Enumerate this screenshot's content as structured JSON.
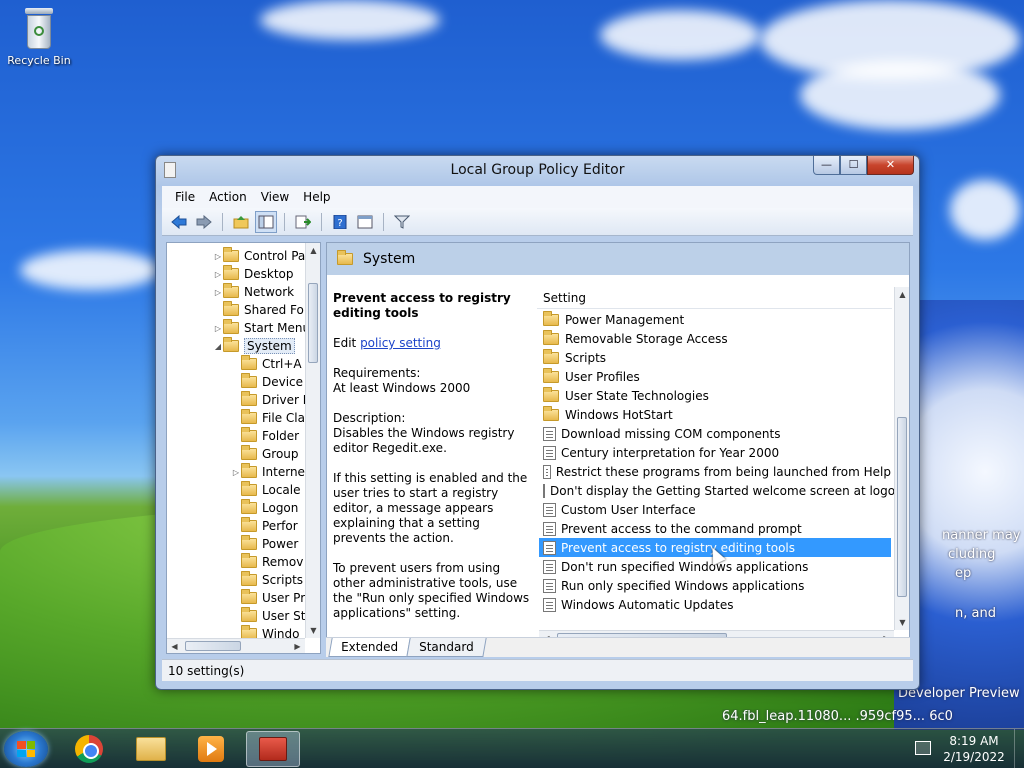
{
  "desktop": {
    "recycle_bin_label": "Recycle Bin",
    "wallpaper_text": {
      "line1": "nanner may",
      "line2": "cluding",
      "line3": "ep",
      "line4": "n, and",
      "developer": "Developer Preview",
      "build": "64.fbl_leap.11080... .959cf95... 6c0"
    }
  },
  "window": {
    "title": "Local Group Policy Editor",
    "controls": {
      "minimize": "—",
      "maximize": "☐",
      "close": "✕"
    },
    "menu": [
      "File",
      "Action",
      "View",
      "Help"
    ],
    "toolbar_icons": [
      "back-arrow-icon",
      "forward-arrow-icon",
      "up-folder-icon",
      "show-hide-tree-icon",
      "export-list-icon",
      "help-icon",
      "properties-icon",
      "filter-icon"
    ]
  },
  "tree": {
    "items": [
      {
        "label": "Control Pa",
        "expander": "▷",
        "level": 2
      },
      {
        "label": "Desktop",
        "expander": "▷",
        "level": 2
      },
      {
        "label": "Network",
        "expander": "▷",
        "level": 2
      },
      {
        "label": "Shared Fol",
        "expander": "",
        "level": 2
      },
      {
        "label": "Start Menu",
        "expander": "▷",
        "level": 2
      },
      {
        "label": "System",
        "expander": "◢",
        "level": 2,
        "selected": true
      },
      {
        "label": "Ctrl+A",
        "expander": "",
        "level": 3
      },
      {
        "label": "Device",
        "expander": "",
        "level": 3
      },
      {
        "label": "Driver I",
        "expander": "",
        "level": 3
      },
      {
        "label": "File Cla",
        "expander": "",
        "level": 3
      },
      {
        "label": "Folder",
        "expander": "",
        "level": 3
      },
      {
        "label": "Group",
        "expander": "",
        "level": 3
      },
      {
        "label": "Interne",
        "expander": "▷",
        "level": 3
      },
      {
        "label": "Locale",
        "expander": "",
        "level": 3
      },
      {
        "label": "Logon",
        "expander": "",
        "level": 3
      },
      {
        "label": "Perfor",
        "expander": "",
        "level": 3
      },
      {
        "label": "Power",
        "expander": "",
        "level": 3
      },
      {
        "label": "Remov",
        "expander": "",
        "level": 3
      },
      {
        "label": "Scripts",
        "expander": "",
        "level": 3
      },
      {
        "label": "User Pr",
        "expander": "",
        "level": 3
      },
      {
        "label": "User St",
        "expander": "",
        "level": 3
      },
      {
        "label": "Windo",
        "expander": "",
        "level": 3
      }
    ]
  },
  "right_pane": {
    "header": "System",
    "description": {
      "title": "Prevent access to registry editing tools",
      "edit_prefix": "Edit ",
      "edit_link": "policy setting",
      "requirements_label": "Requirements:",
      "requirements_value": "At least Windows 2000",
      "description_label": "Description:",
      "description_text": "Disables the Windows registry editor Regedit.exe.",
      "para2": "If this setting is enabled and the user tries to start a registry editor, a message appears explaining that a setting prevents the action.",
      "para3": "To prevent users from using other administrative tools, use the \"Run only specified Windows applications\" setting."
    },
    "list_header": "Setting",
    "rows": [
      {
        "label": "Power Management",
        "type": "folder"
      },
      {
        "label": "Removable Storage Access",
        "type": "folder"
      },
      {
        "label": "Scripts",
        "type": "folder"
      },
      {
        "label": "User Profiles",
        "type": "folder"
      },
      {
        "label": "User State Technologies",
        "type": "folder"
      },
      {
        "label": "Windows HotStart",
        "type": "folder"
      },
      {
        "label": "Download missing COM components",
        "type": "policy"
      },
      {
        "label": "Century interpretation for Year 2000",
        "type": "policy"
      },
      {
        "label": "Restrict these programs from being launched from Help",
        "type": "policy"
      },
      {
        "label": "Don't display the Getting Started welcome screen at logon",
        "type": "policy"
      },
      {
        "label": "Custom User Interface",
        "type": "policy"
      },
      {
        "label": "Prevent access to the command prompt",
        "type": "policy"
      },
      {
        "label": "Prevent access to registry editing tools",
        "type": "policy",
        "selected": true
      },
      {
        "label": "Don't run specified Windows applications",
        "type": "policy"
      },
      {
        "label": "Run only specified Windows applications",
        "type": "policy"
      },
      {
        "label": "Windows Automatic Updates",
        "type": "policy"
      }
    ],
    "tabs": [
      "Extended",
      "Standard"
    ]
  },
  "status": {
    "text": "10 setting(s)"
  },
  "taskbar": {
    "apps": [
      "chrome-icon",
      "explorer-icon",
      "media-player-icon",
      "group-policy-icon"
    ],
    "clock_time": "8:19 AM",
    "clock_date": "2/19/2022"
  }
}
